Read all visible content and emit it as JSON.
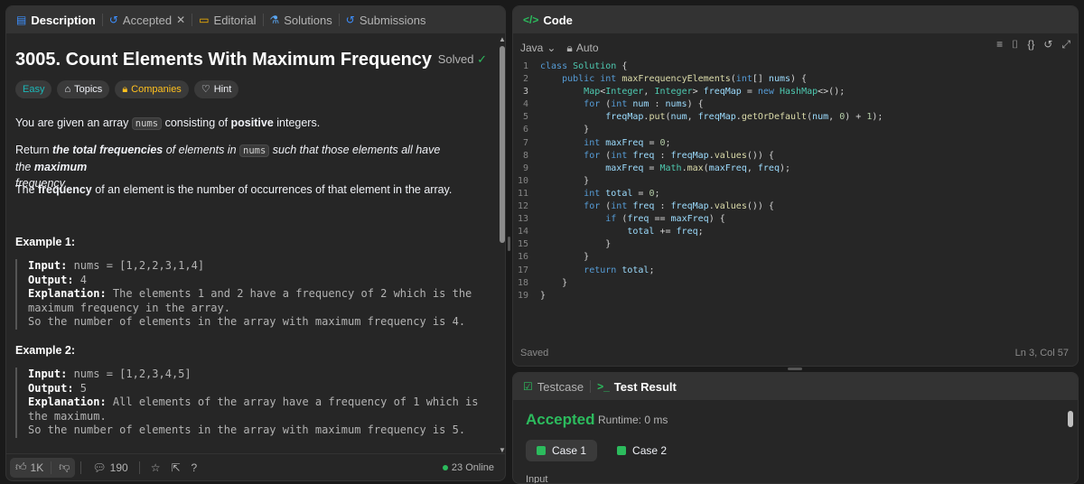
{
  "left_tabs": [
    {
      "label": "Description",
      "icon": "description-icon"
    },
    {
      "label": "Accepted",
      "icon": "history-icon"
    },
    {
      "label": "Editorial",
      "icon": "book-icon"
    },
    {
      "label": "Solutions",
      "icon": "flask-icon"
    },
    {
      "label": "Submissions",
      "icon": "history-icon"
    }
  ],
  "problem": {
    "title": "3005. Count Elements With Maximum Frequency",
    "solved_label": "Solved",
    "tags": [
      "Easy",
      "Topics",
      "Companies",
      "Hint"
    ],
    "p1_a": "You are given an array ",
    "p1_code": "nums",
    "p1_b": " consisting of ",
    "p1_bold": "positive",
    "p1_c": " integers.",
    "p2_a": "Return ",
    "p2_bold1": "the total frequencies",
    "p2_b": " of elements in ",
    "p2_code": "nums",
    "p2_c": " such that those elements all have the ",
    "p2_bold2": "maximum",
    "p2_d": "frequency.",
    "p3_a": "The ",
    "p3_bold": "frequency",
    "p3_b": " of an element is the number of occurrences of that element in the array.",
    "examples": [
      {
        "heading": "Example 1:",
        "input_label": "Input:",
        "input": " nums = [1,2,2,3,1,4]",
        "output_label": "Output:",
        "output": " 4",
        "expl_label": "Explanation:",
        "expl": " The elements 1 and 2 have a frequency of 2 which is the maximum frequency in the array.\nSo the number of elements in the array with maximum frequency is 4."
      },
      {
        "heading": "Example 2:",
        "input_label": "Input:",
        "input": " nums = [1,2,3,4,5]",
        "output_label": "Output:",
        "output": " 5",
        "expl_label": "Explanation:",
        "expl": " All elements of the array have a frequency of 1 which is the maximum.\nSo the number of elements in the array with maximum frequency is 5."
      }
    ]
  },
  "footer": {
    "likes": "1K",
    "comments": "190",
    "online": "23 Online"
  },
  "code_panel": {
    "title": "Code",
    "language": "Java",
    "mode": "Auto",
    "status": "Saved",
    "cursor": "Ln 3, Col 57",
    "lines": [
      "class Solution {",
      "    public int maxFrequencyElements(int[] nums) {",
      "        Map<Integer, Integer> freqMap = new HashMap<>();",
      "        for (int num : nums) {",
      "            freqMap.put(num, freqMap.getOrDefault(num, 0) + 1);",
      "        }",
      "        int maxFreq = 0;",
      "        for (int freq : freqMap.values()) {",
      "            maxFreq = Math.max(maxFreq, freq);",
      "        }",
      "        int total = 0;",
      "        for (int freq : freqMap.values()) {",
      "            if (freq == maxFreq) {",
      "                total += freq;",
      "            }",
      "        }",
      "        return total;",
      "    }",
      "}"
    ]
  },
  "result_panel": {
    "tab_testcase": "Testcase",
    "tab_result": "Test Result",
    "verdict": "Accepted",
    "runtime": "Runtime: 0 ms",
    "cases": [
      "Case 1",
      "Case 2"
    ],
    "input_label": "Input"
  },
  "colors": {
    "accent_green": "#2cbb5d",
    "easy": "#1cb8b8",
    "companies": "#ffc01e"
  }
}
